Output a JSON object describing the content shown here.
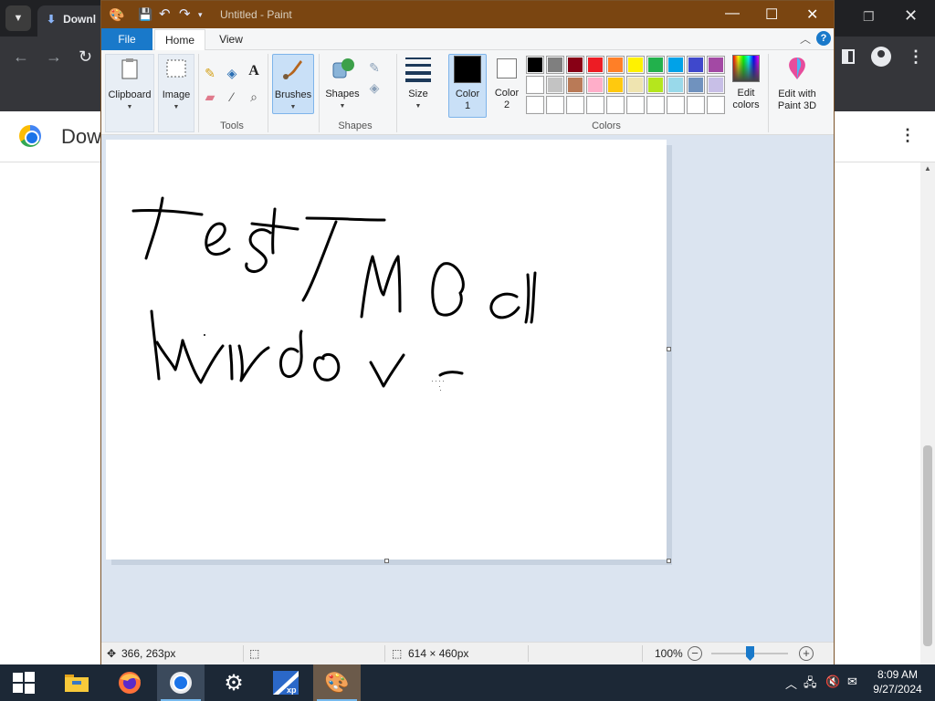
{
  "chrome": {
    "tab_title": "Downl",
    "page_title": "Dow"
  },
  "paint": {
    "window_title": "Untitled - Paint",
    "tabs": [
      "File",
      "Home",
      "View"
    ],
    "ribbon": {
      "clipboard": "Clipboard",
      "image": "Image",
      "tools_group": "Tools",
      "brushes": "Brushes",
      "shapes": "Shapes",
      "shapes_group": "Shapes",
      "size": "Size",
      "color1_line1": "Color",
      "color1_line2": "1",
      "color2_line1": "Color",
      "color2_line2": "2",
      "colors_group": "Colors",
      "edit_colors_line1": "Edit",
      "edit_colors_line2": "colors",
      "edit_paint3d_line1": "Edit with",
      "edit_paint3d_line2": "Paint 3D",
      "color1": "#000000",
      "color2": "#ffffff",
      "palette_row1": [
        "#000000",
        "#7f7f7f",
        "#880015",
        "#ed1c24",
        "#ff7f27",
        "#fff200",
        "#22b14c",
        "#00a2e8",
        "#3f48cc",
        "#a349a4"
      ],
      "palette_row2": [
        "#ffffff",
        "#c3c3c3",
        "#b97a57",
        "#ffaec9",
        "#ffc90e",
        "#efe4b0",
        "#b5e61d",
        "#99d9ea",
        "#7092be",
        "#c8bfe7"
      ],
      "palette_row3": [
        "#ffffff",
        "#ffffff",
        "#ffffff",
        "#ffffff",
        "#ffffff",
        "#ffffff",
        "#ffffff",
        "#ffffff",
        "#ffffff",
        "#ffffff"
      ]
    },
    "status": {
      "cursor_pos": "366, 263px",
      "image_size": "614 × 460px",
      "zoom": "100%"
    }
  },
  "taskbar": {
    "time": "8:09 AM",
    "date": "9/27/2024"
  }
}
